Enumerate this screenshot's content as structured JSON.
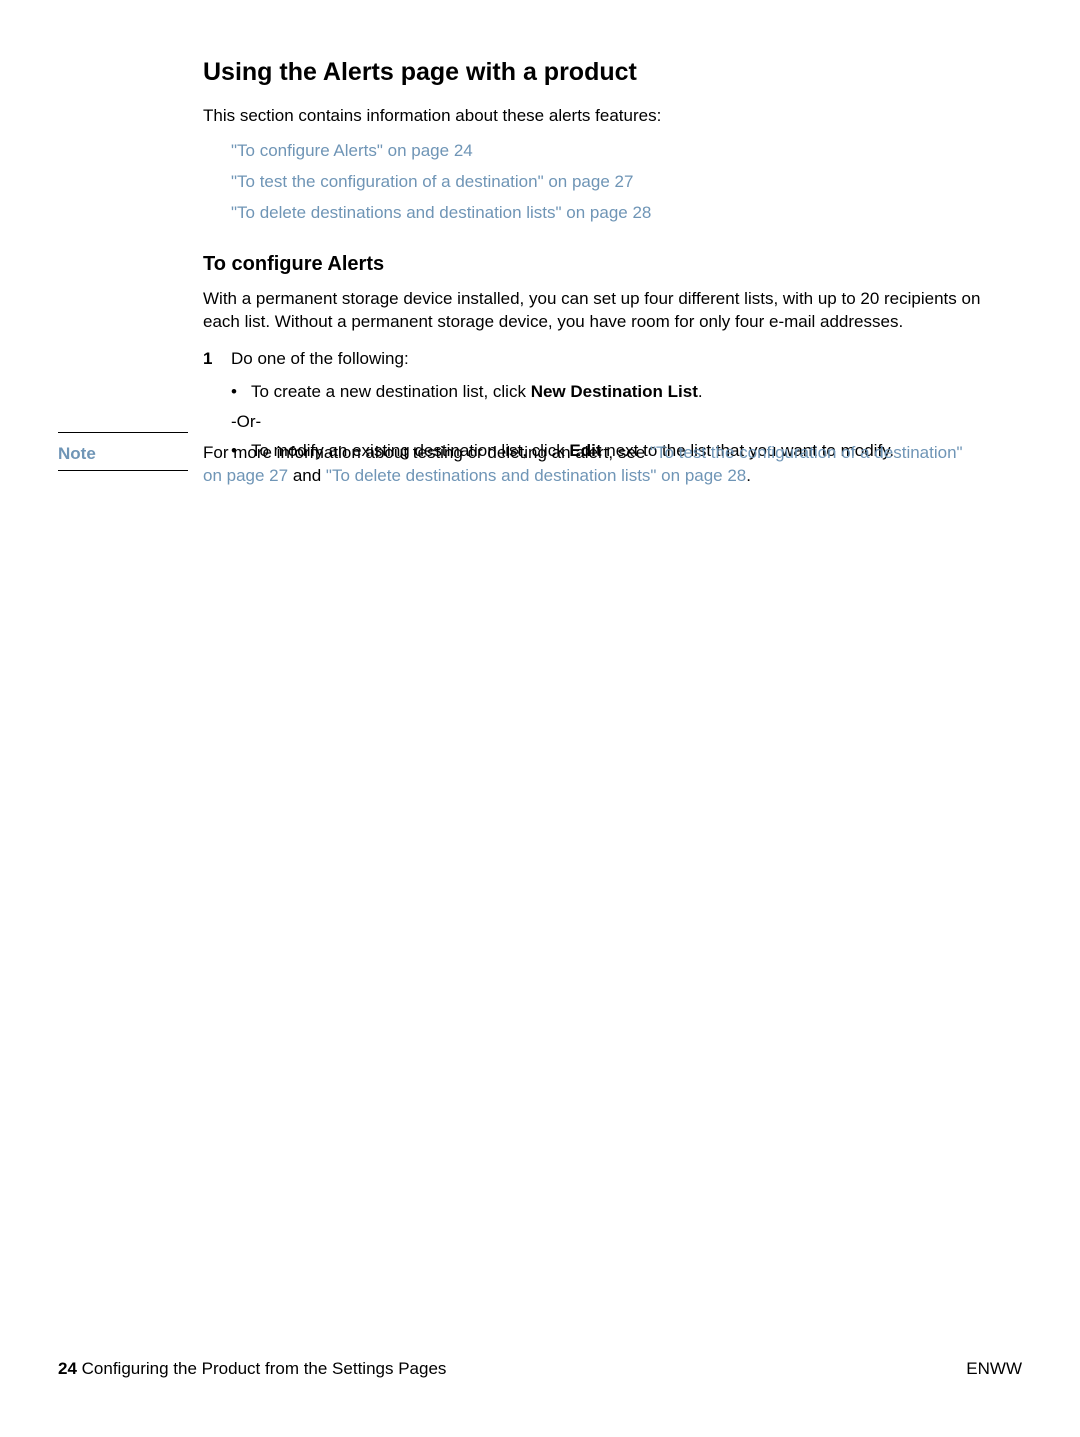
{
  "heading1": "Using the Alerts page with a product",
  "intro": "This section contains information about these alerts features:",
  "links": {
    "l1": "\"To configure Alerts\" on page 24",
    "l2": "\"To test the configuration of a destination\" on page 27",
    "l3": "\"To delete destinations and destination lists\" on page 28"
  },
  "heading2": "To configure Alerts",
  "para1": "With a permanent storage device installed, you can set up four different lists, with up to 20 recipients on each list. Without a permanent storage device, you have room for only four e-mail addresses.",
  "step1": {
    "num": "1",
    "text": "Do one of the following:"
  },
  "bullet1": {
    "pre": "To create a new destination list, click ",
    "bold": "New Destination List",
    "post": "."
  },
  "or": "-Or-",
  "bullet2": {
    "pre": "To modify an existing destination list, click ",
    "bold": "Edit",
    "post": " next to the list that you want to modify."
  },
  "note": {
    "label": "Note",
    "pre": "For more information about testing or deleting an alert, see ",
    "link1": "\"To test the configuration of a destination\" on page 27",
    "mid": " and ",
    "link2": "\"To delete destinations and destination lists\" on page 28",
    "post": "."
  },
  "footer": {
    "page_num": "24",
    "chapter": " Configuring the Product from the Settings Pages",
    "right": "ENWW"
  }
}
